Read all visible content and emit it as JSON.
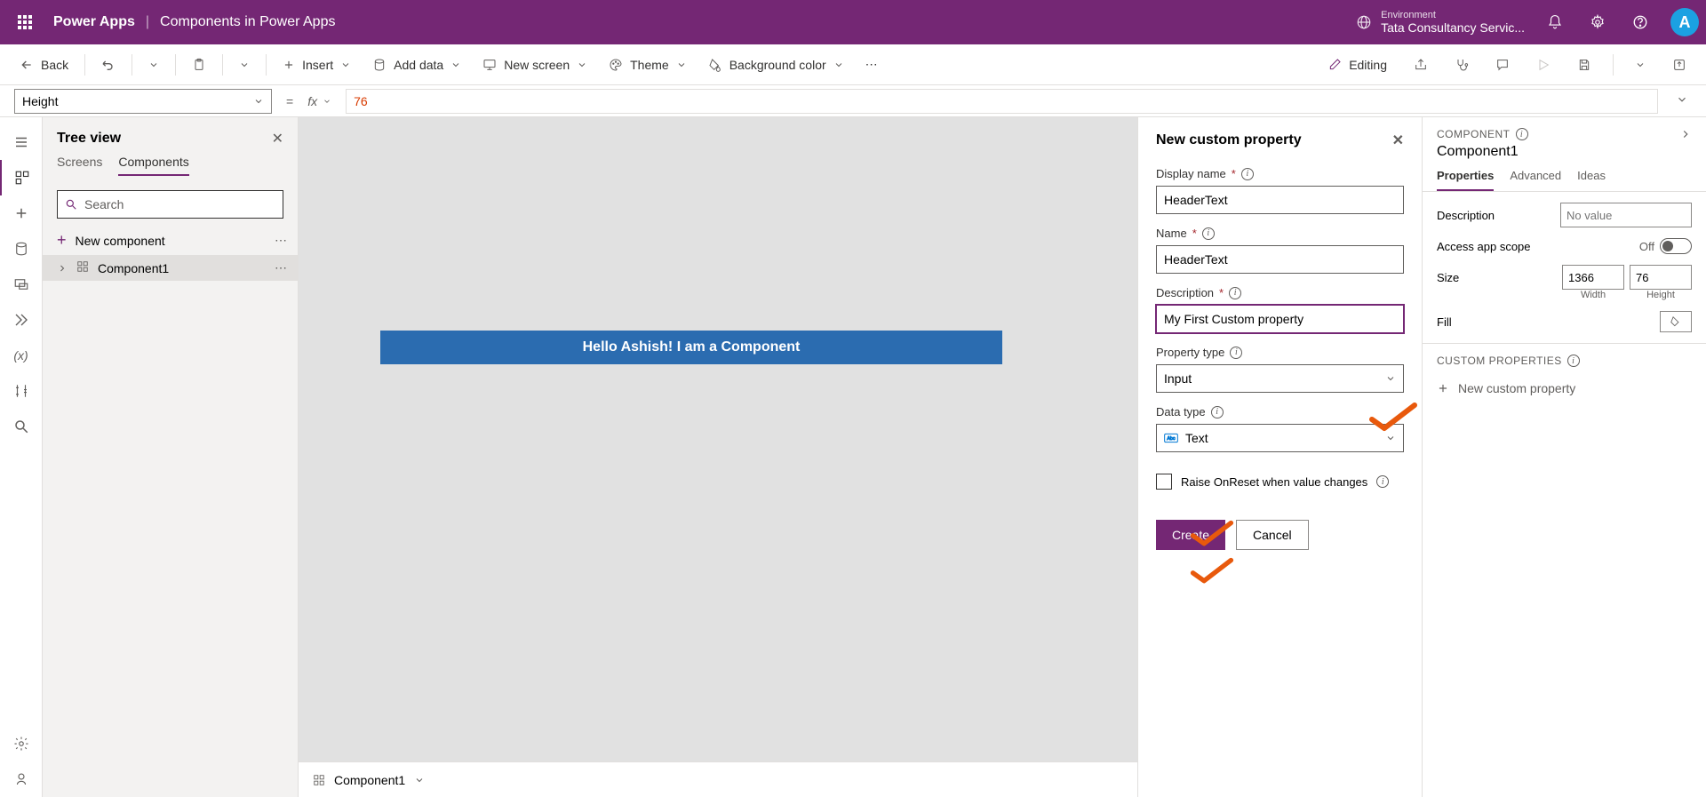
{
  "header": {
    "app_name": "Power Apps",
    "page_title": "Components in Power Apps",
    "env_label": "Environment",
    "env_name": "Tata Consultancy Servic...",
    "avatar_initial": "A"
  },
  "toolbar": {
    "back": "Back",
    "insert": "Insert",
    "add_data": "Add data",
    "new_screen": "New screen",
    "theme": "Theme",
    "bg_color": "Background color",
    "editing": "Editing"
  },
  "formula": {
    "property": "Height",
    "equals": "=",
    "fx": "fx",
    "value": "76"
  },
  "tree": {
    "title": "Tree view",
    "tab_screens": "Screens",
    "tab_components": "Components",
    "search_placeholder": "Search",
    "new_component": "New component",
    "item1": "Component1"
  },
  "canvas": {
    "hello_text": "Hello Ashish! I am a Component",
    "footer_name": "Component1"
  },
  "new_prop_panel": {
    "title": "New custom property",
    "display_name_label": "Display name",
    "display_name_value": "HeaderText",
    "name_label": "Name",
    "name_value": "HeaderText",
    "description_label": "Description",
    "description_value": "My First Custom property",
    "prop_type_label": "Property type",
    "prop_type_value": "Input",
    "data_type_label": "Data type",
    "data_type_value": "Text",
    "raise_onreset": "Raise OnReset when value changes",
    "create": "Create",
    "cancel": "Cancel"
  },
  "right_panel": {
    "label": "COMPONENT",
    "name": "Component1",
    "tab_props": "Properties",
    "tab_adv": "Advanced",
    "tab_ideas": "Ideas",
    "description_label": "Description",
    "description_placeholder": "No value",
    "access_scope_label": "Access app scope",
    "access_scope_off": "Off",
    "size_label": "Size",
    "width_value": "1366",
    "height_value": "76",
    "width_label": "Width",
    "height_label": "Height",
    "fill_label": "Fill",
    "custom_props_label": "CUSTOM PROPERTIES",
    "new_custom_prop": "New custom property"
  }
}
